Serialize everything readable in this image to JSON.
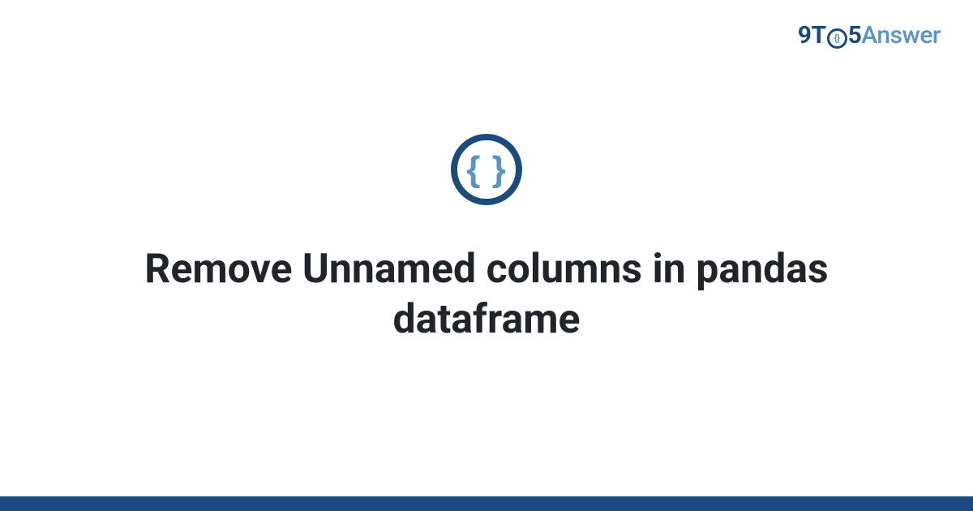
{
  "header": {
    "logo": {
      "prefix": "9T",
      "o_content": "{}",
      "middle": "5",
      "suffix": "Answer"
    }
  },
  "content": {
    "icon_braces": "{ }",
    "title": "Remove Unnamed columns in pandas dataframe"
  }
}
